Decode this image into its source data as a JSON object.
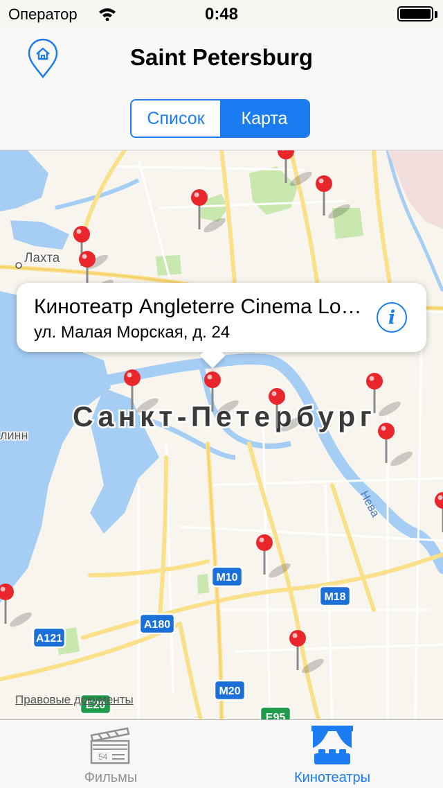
{
  "status_bar": {
    "carrier": "Оператор",
    "time": "0:48",
    "battery_level": 1.0
  },
  "nav": {
    "title": "Saint Petersburg"
  },
  "segment": {
    "items": [
      "Список",
      "Карта"
    ],
    "selected": "Карта"
  },
  "map": {
    "city_label": "Санкт-Петербург",
    "place_labels": [
      "Лахта",
      "линн",
      "Нева"
    ],
    "road_shields": [
      "M10",
      "M18",
      "A180",
      "A121",
      "M20",
      "E20",
      "E95"
    ],
    "legal_link": "Правовые документы"
  },
  "callout": {
    "title": "Кинотеатр Angleterre Cinema Lounge",
    "subtitle": "ул. Малая Морская, д. 24",
    "info_icon": "info-icon"
  },
  "tabbar": {
    "items": [
      {
        "label": "Фильмы",
        "icon": "clapperboard-icon",
        "selected": false
      },
      {
        "label": "Кинотеатры",
        "icon": "theater-icon",
        "selected": true
      }
    ]
  },
  "colors": {
    "accent": "#1a7cf0",
    "pin": "#e8262b",
    "water": "#a6cef5",
    "park": "#c9e8b0",
    "road": "#fbe08a"
  }
}
